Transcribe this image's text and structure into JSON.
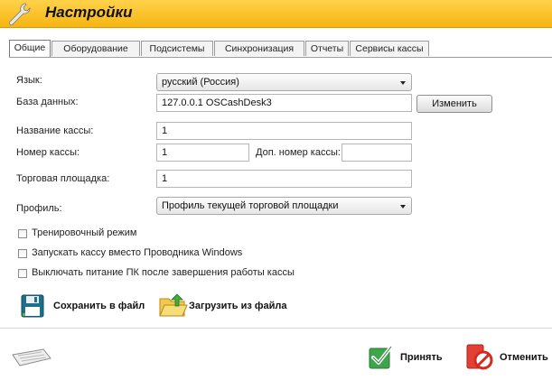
{
  "window": {
    "title": "Настройки"
  },
  "tabs": [
    {
      "label": "Общие",
      "active": true
    },
    {
      "label": "Оборудование",
      "active": false
    },
    {
      "label": "Подсистемы",
      "active": false
    },
    {
      "label": "Синхронизация",
      "active": false
    },
    {
      "label": "Отчеты",
      "active": false
    },
    {
      "label": "Сервисы кассы",
      "active": false
    }
  ],
  "form": {
    "language": {
      "label": "Язык:",
      "value": "русский (Россия)"
    },
    "database": {
      "label": "База данных:",
      "value": "127.0.0.1 OSCashDesk3",
      "change_button": "Изменить"
    },
    "cashdesk_name": {
      "label": "Название кассы:",
      "value": "1"
    },
    "cashdesk_number": {
      "label": "Номер кассы:",
      "value": "1"
    },
    "extra_number": {
      "label": "Доп. номер кассы:",
      "value": ""
    },
    "trade_place": {
      "label": "Торговая площадка:",
      "value": "1"
    },
    "profile": {
      "label": "Профиль:",
      "value": "Профиль текущей торговой площадки"
    }
  },
  "checkboxes": [
    {
      "label": "Тренировочный режим",
      "checked": false
    },
    {
      "label": "Запускать кассу вместо Проводника Windows",
      "checked": false
    },
    {
      "label": "Выключать питание ПК после завершения работы кассы",
      "checked": false
    }
  ],
  "file_actions": {
    "save": "Сохранить в файл",
    "load": "Загрузить из файла"
  },
  "footer": {
    "accept": "Принять",
    "cancel": "Отменить"
  },
  "icons": {
    "title": "wrench-icon",
    "save": "floppy-disk-icon",
    "load": "open-folder-icon",
    "keyboard": "keyboard-icon",
    "accept": "checkmark-icon",
    "cancel": "cancel-icon"
  },
  "colors": {
    "titlebar": "#f6b511",
    "accept": "#4caf3a",
    "cancel": "#e0392f"
  }
}
